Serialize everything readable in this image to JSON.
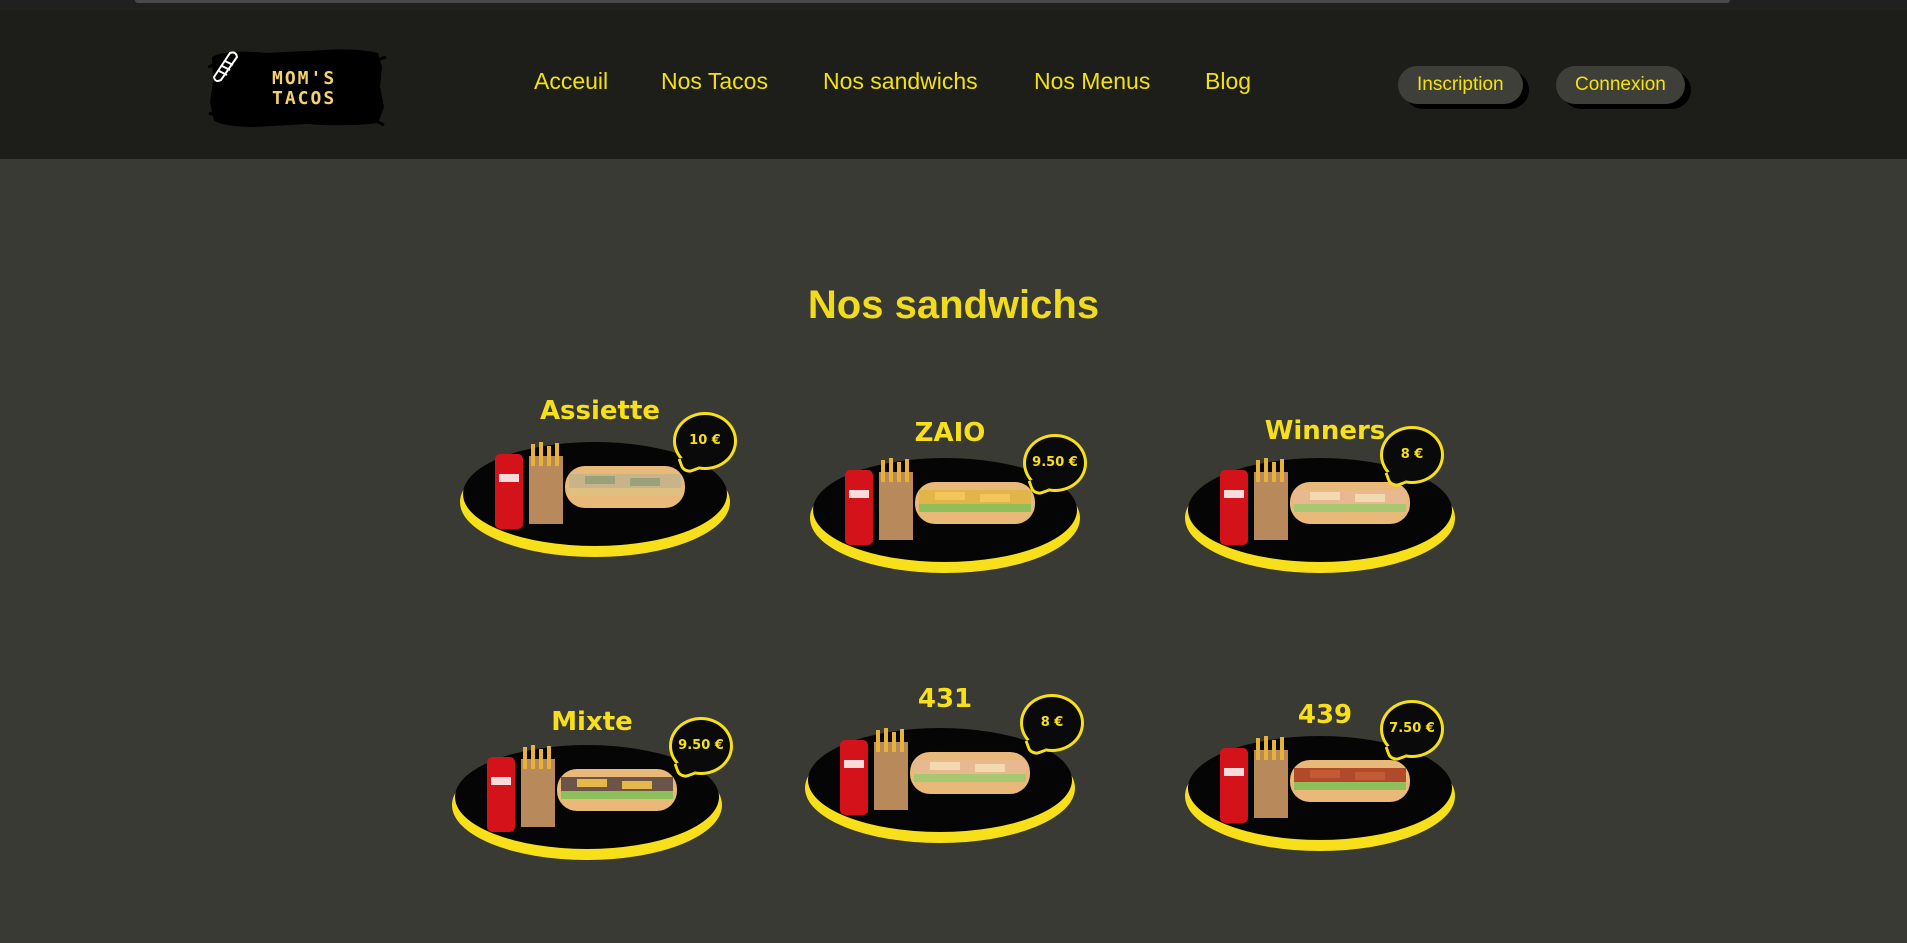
{
  "brand": {
    "logo_line1": "MOM'S",
    "logo_line2": "TACOS"
  },
  "nav": [
    {
      "label": "Acceuil"
    },
    {
      "label": "Nos Tacos"
    },
    {
      "label": "Nos sandwichs"
    },
    {
      "label": "Nos Menus"
    },
    {
      "label": "Blog"
    }
  ],
  "auth": {
    "signup_label": "Inscription",
    "login_label": "Connexion"
  },
  "main": {
    "title": "Nos sandwichs",
    "cards": [
      {
        "name": "Assiette",
        "price": "10 €",
        "filling": "plate"
      },
      {
        "name": "ZAIO",
        "price": "9.50 €",
        "filling": "chicken"
      },
      {
        "name": "Winners",
        "price": "8 €",
        "filling": "tenders"
      },
      {
        "name": "Mixte",
        "price": "9.50 €",
        "filling": "mixed"
      },
      {
        "name": "431",
        "price": "8 €",
        "filling": "tenders"
      },
      {
        "name": "439",
        "price": "7.50 €",
        "filling": "sausage"
      }
    ]
  },
  "colors": {
    "accent": "#f3e20f",
    "header_bg": "#1d1d19",
    "page_bg": "#3a3a35"
  }
}
